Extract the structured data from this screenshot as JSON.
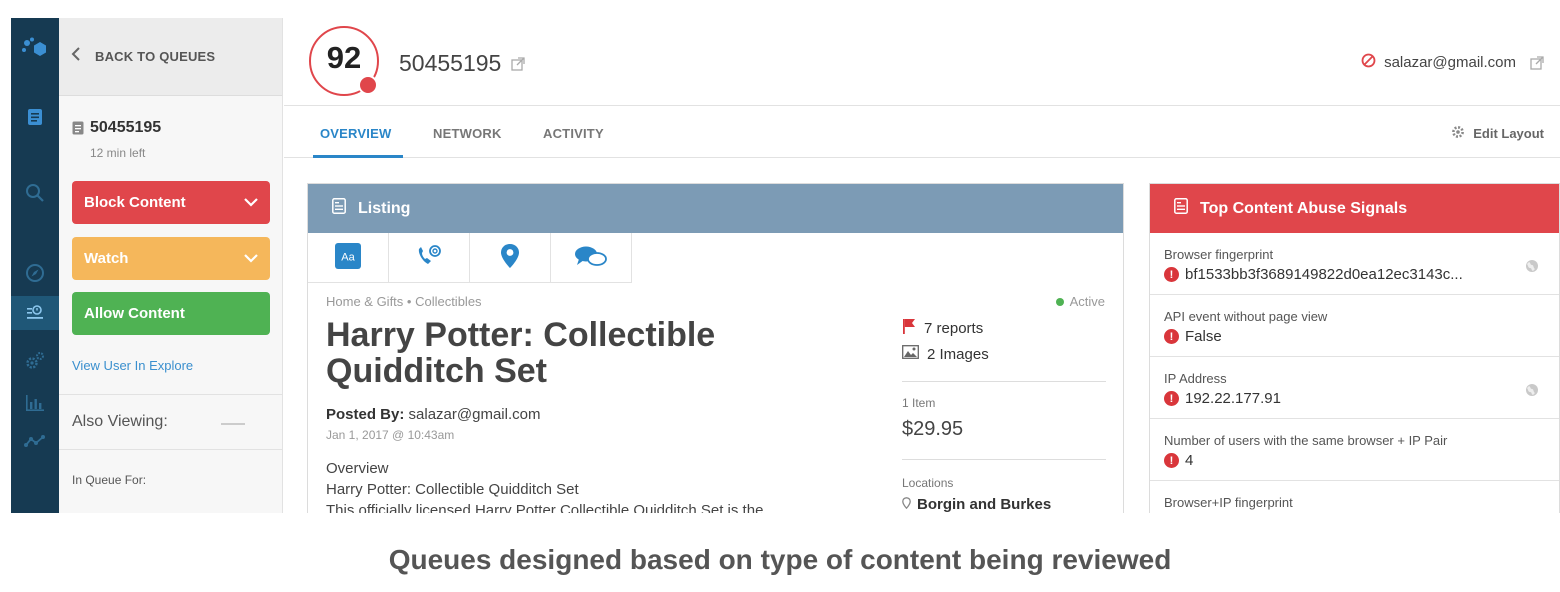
{
  "queue_panel": {
    "back_label": "BACK TO QUEUES",
    "item_id": "50455195",
    "time_left": "12 min left",
    "block_label": "Block Content",
    "watch_label": "Watch",
    "allow_label": "Allow Content",
    "view_user_link": "View User In Explore",
    "also_viewing_label": "Also Viewing:",
    "in_queue_label": "In Queue For:"
  },
  "header": {
    "score": "92",
    "item_id": "50455195",
    "user_email": "salazar@gmail.com"
  },
  "tabs": {
    "overview": "OVERVIEW",
    "network": "NETWORK",
    "activity": "ACTIVITY",
    "edit_layout": "Edit Layout"
  },
  "listing": {
    "heading": "Listing",
    "breadcrumb": "Home & Gifts • Collectibles",
    "status": "Active",
    "title": "Harry Potter: Collectible Quidditch Set",
    "posted_by_label": "Posted By:",
    "posted_by_value": "salazar@gmail.com",
    "posted_date": "Jan 1, 2017 @ 10:43am",
    "overview_heading": "Overview",
    "overview_title": "Harry Potter: Collectible Quidditch Set",
    "overview_body": "This officially licensed Harry Potter Collectible Quidditch Set is the",
    "reports": "7 reports",
    "images": "2 Images",
    "quantity": "1 Item",
    "price": "$29.95",
    "locations_label": "Locations",
    "location": "Borgin and Burkes"
  },
  "signals": {
    "heading": "Top Content Abuse Signals",
    "items": [
      {
        "label": "Browser fingerprint",
        "value": "bf1533bb3f3689149822d0ea12ec3143c..."
      },
      {
        "label": "API event without page view",
        "value": "False"
      },
      {
        "label": "IP Address",
        "value": "192.22.177.91"
      },
      {
        "label": "Number of users with the same browser + IP Pair",
        "value": "4"
      },
      {
        "label": "Browser+IP fingerprint",
        "value": ""
      }
    ]
  },
  "caption": "Queues designed based on type of content being reviewed",
  "colors": {
    "rail": "#163a52",
    "block": "#e0464b",
    "watch": "#f5b75b",
    "allow": "#4fb253",
    "listing_header": "#7c9bb5",
    "signals_header": "#e0464b",
    "accent_blue": "#2a86c8"
  },
  "icons": {
    "rail": [
      "logo-icon",
      "document-icon",
      "search-icon",
      "compass-icon",
      "queue-icon",
      "gears-icon",
      "bar-chart-icon",
      "network-icon"
    ],
    "listing_tabs": [
      "text-icon",
      "contact-icon",
      "location-pin-icon",
      "chat-bubbles-icon"
    ]
  }
}
